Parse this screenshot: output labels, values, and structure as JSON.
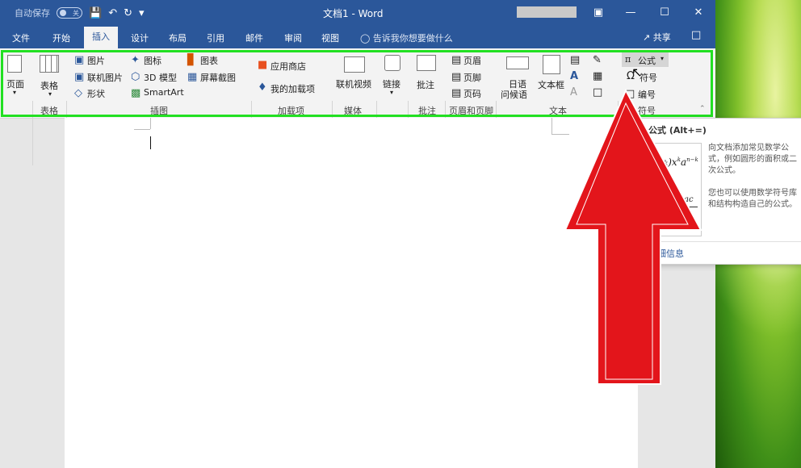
{
  "titlebar": {
    "autosave": "自动保存",
    "autosave_state": "关",
    "doc_title": "文档1 - Word"
  },
  "tabs": [
    "文件",
    "开始",
    "插入",
    "设计",
    "布局",
    "引用",
    "邮件",
    "审阅",
    "视图"
  ],
  "tell_me": "告诉我你想要做什么",
  "share": "共享",
  "ribbon": {
    "pages": "页面",
    "table": "表格",
    "pictures": "图片",
    "online_pictures": "联机图片",
    "shapes": "形状",
    "icons": "图标",
    "models_3d": "3D 模型",
    "smartart": "SmartArt",
    "chart": "图表",
    "screenshot": "屏幕截图",
    "store": "应用商店",
    "my_addins": "我的加载项",
    "online_video": "联机视频",
    "link": "链接",
    "comment": "批注",
    "header": "页眉",
    "footer": "页脚",
    "page_number": "页码",
    "japanese_greetings": "日语\n问候语",
    "japanese_line1": "日语",
    "japanese_line2": "问候语",
    "textbox": "文本框",
    "equation": "公式",
    "symbol": "符号",
    "numbering": "编号"
  },
  "groups": {
    "tables": "表格",
    "illustrations": "插图",
    "addins": "加载项",
    "media": "媒体",
    "comments": "批注",
    "header_footer": "页眉和页脚",
    "text": "文本",
    "symbols": "符号"
  },
  "tooltip": {
    "title": "插入公式 (Alt+=)",
    "desc1": "向文档添加常见数学公式，例如圆形的面积或二次公式。",
    "desc2": "您也可以使用数学符号库和结构构造自己的公式。",
    "link": "详细信息"
  },
  "colors": {
    "accent": "#2b579a",
    "highlight": "#22e022",
    "arrow": "#e3151b"
  }
}
